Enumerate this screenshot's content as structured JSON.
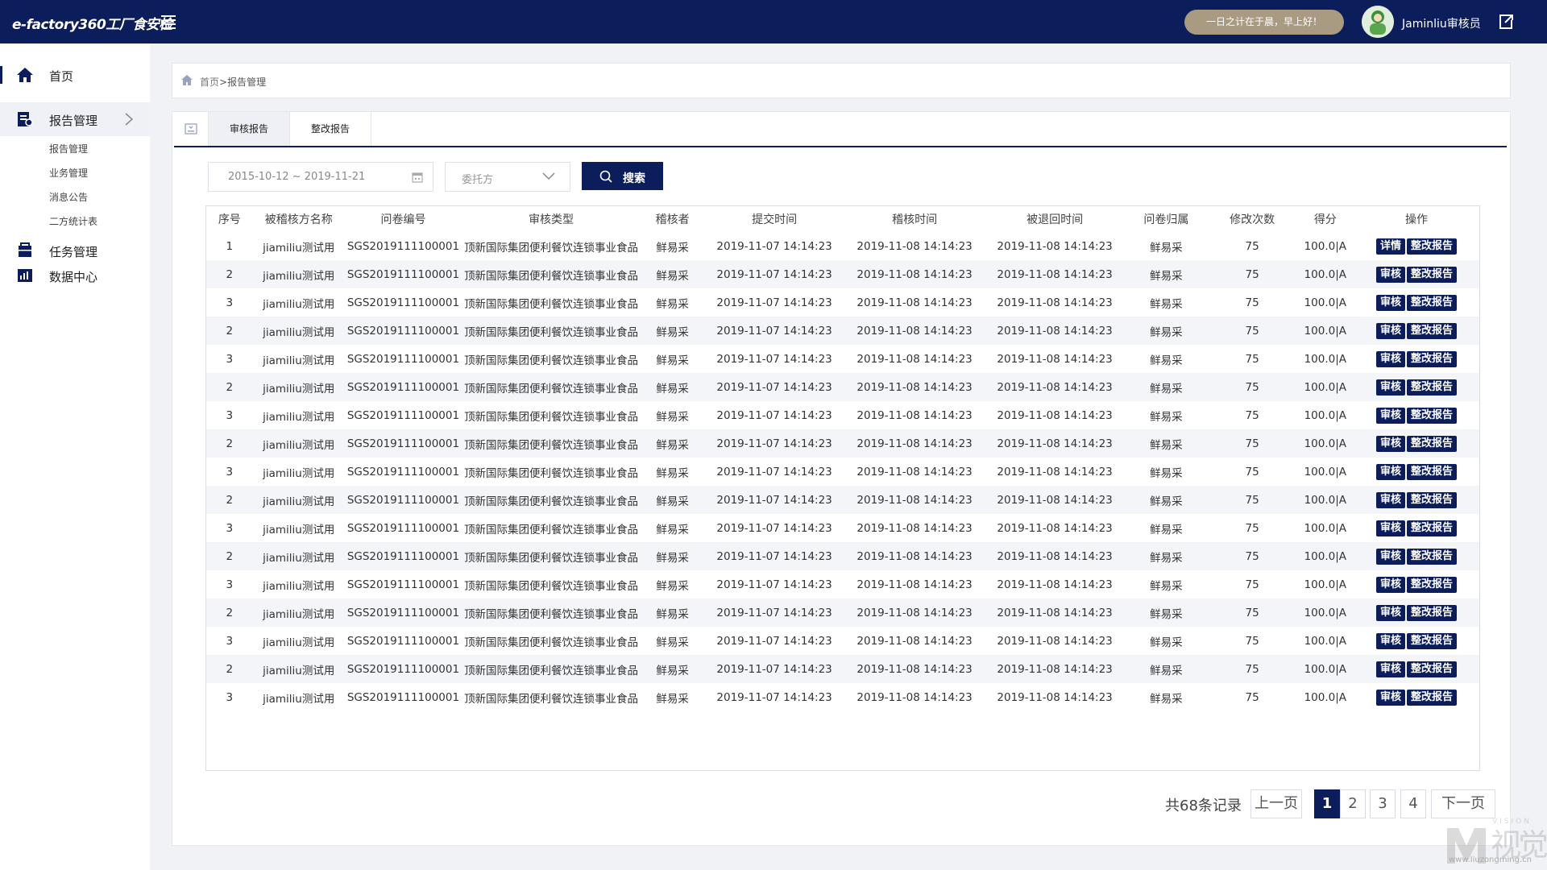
{
  "header": {
    "logo": "e-factory360工厂食安检",
    "slogan": "一日之计在于晨，早上好！",
    "username": "Jaminliu审核员"
  },
  "sidebar": {
    "items": [
      {
        "label": "首页",
        "icon": "home-icon"
      },
      {
        "label": "报告管理",
        "icon": "report-icon"
      },
      {
        "label": "任务管理",
        "icon": "task-icon"
      },
      {
        "label": "数据中心",
        "icon": "chart-icon"
      }
    ],
    "subitems": [
      "报告管理",
      "业务管理",
      "消息公告",
      "二方统计表"
    ]
  },
  "breadcrumb": {
    "home": "首页",
    "sep": ">",
    "current": "报告管理"
  },
  "tabs": [
    "审核报告",
    "整改报告"
  ],
  "filters": {
    "date_range": "2015-10-12 ~ 2019-11-21",
    "client_placeholder": "委托方",
    "search_label": "搜索"
  },
  "table": {
    "headers": [
      "序号",
      "被稽核方名称",
      "问卷编号",
      "审核类型",
      "稽核者",
      "提交时间",
      "稽核时间",
      "被退回时间",
      "问卷归属",
      "修改次数",
      "得分",
      "操作"
    ],
    "rows": [
      {
        "no": "1",
        "name": "jiamiliu测试用",
        "code": "SGS2019111100001",
        "type": "顶新国际集团便利餐饮连锁事业食品",
        "auditor": "鲜易采",
        "submit": "2019-11-07 14:14:23",
        "audit": "2019-11-08 14:14:23",
        "returned": "2019-11-08 14:14:23",
        "owner": "鲜易采",
        "edits": "75",
        "score": "100.0|A",
        "op1": "详情",
        "op2": "整改报告"
      },
      {
        "no": "2",
        "name": "jiamiliu测试用",
        "code": "SGS2019111100001",
        "type": "顶新国际集团便利餐饮连锁事业食品",
        "auditor": "鲜易采",
        "submit": "2019-11-07 14:14:23",
        "audit": "2019-11-08 14:14:23",
        "returned": "2019-11-08 14:14:23",
        "owner": "鲜易采",
        "edits": "75",
        "score": "100.0|A",
        "op1": "审核",
        "op2": "整改报告"
      },
      {
        "no": "3",
        "name": "jiamiliu测试用",
        "code": "SGS2019111100001",
        "type": "顶新国际集团便利餐饮连锁事业食品",
        "auditor": "鲜易采",
        "submit": "2019-11-07 14:14:23",
        "audit": "2019-11-08 14:14:23",
        "returned": "2019-11-08 14:14:23",
        "owner": "鲜易采",
        "edits": "75",
        "score": "100.0|A",
        "op1": "审核",
        "op2": "整改报告"
      },
      {
        "no": "2",
        "name": "jiamiliu测试用",
        "code": "SGS2019111100001",
        "type": "顶新国际集团便利餐饮连锁事业食品",
        "auditor": "鲜易采",
        "submit": "2019-11-07 14:14:23",
        "audit": "2019-11-08 14:14:23",
        "returned": "2019-11-08 14:14:23",
        "owner": "鲜易采",
        "edits": "75",
        "score": "100.0|A",
        "op1": "审核",
        "op2": "整改报告"
      },
      {
        "no": "3",
        "name": "jiamiliu测试用",
        "code": "SGS2019111100001",
        "type": "顶新国际集团便利餐饮连锁事业食品",
        "auditor": "鲜易采",
        "submit": "2019-11-07 14:14:23",
        "audit": "2019-11-08 14:14:23",
        "returned": "2019-11-08 14:14:23",
        "owner": "鲜易采",
        "edits": "75",
        "score": "100.0|A",
        "op1": "审核",
        "op2": "整改报告"
      },
      {
        "no": "2",
        "name": "jiamiliu测试用",
        "code": "SGS2019111100001",
        "type": "顶新国际集团便利餐饮连锁事业食品",
        "auditor": "鲜易采",
        "submit": "2019-11-07 14:14:23",
        "audit": "2019-11-08 14:14:23",
        "returned": "2019-11-08 14:14:23",
        "owner": "鲜易采",
        "edits": "75",
        "score": "100.0|A",
        "op1": "审核",
        "op2": "整改报告"
      },
      {
        "no": "3",
        "name": "jiamiliu测试用",
        "code": "SGS2019111100001",
        "type": "顶新国际集团便利餐饮连锁事业食品",
        "auditor": "鲜易采",
        "submit": "2019-11-07 14:14:23",
        "audit": "2019-11-08 14:14:23",
        "returned": "2019-11-08 14:14:23",
        "owner": "鲜易采",
        "edits": "75",
        "score": "100.0|A",
        "op1": "审核",
        "op2": "整改报告"
      },
      {
        "no": "2",
        "name": "jiamiliu测试用",
        "code": "SGS2019111100001",
        "type": "顶新国际集团便利餐饮连锁事业食品",
        "auditor": "鲜易采",
        "submit": "2019-11-07 14:14:23",
        "audit": "2019-11-08 14:14:23",
        "returned": "2019-11-08 14:14:23",
        "owner": "鲜易采",
        "edits": "75",
        "score": "100.0|A",
        "op1": "审核",
        "op2": "整改报告"
      },
      {
        "no": "3",
        "name": "jiamiliu测试用",
        "code": "SGS2019111100001",
        "type": "顶新国际集团便利餐饮连锁事业食品",
        "auditor": "鲜易采",
        "submit": "2019-11-07 14:14:23",
        "audit": "2019-11-08 14:14:23",
        "returned": "2019-11-08 14:14:23",
        "owner": "鲜易采",
        "edits": "75",
        "score": "100.0|A",
        "op1": "审核",
        "op2": "整改报告"
      },
      {
        "no": "2",
        "name": "jiamiliu测试用",
        "code": "SGS2019111100001",
        "type": "顶新国际集团便利餐饮连锁事业食品",
        "auditor": "鲜易采",
        "submit": "2019-11-07 14:14:23",
        "audit": "2019-11-08 14:14:23",
        "returned": "2019-11-08 14:14:23",
        "owner": "鲜易采",
        "edits": "75",
        "score": "100.0|A",
        "op1": "审核",
        "op2": "整改报告"
      },
      {
        "no": "3",
        "name": "jiamiliu测试用",
        "code": "SGS2019111100001",
        "type": "顶新国际集团便利餐饮连锁事业食品",
        "auditor": "鲜易采",
        "submit": "2019-11-07 14:14:23",
        "audit": "2019-11-08 14:14:23",
        "returned": "2019-11-08 14:14:23",
        "owner": "鲜易采",
        "edits": "75",
        "score": "100.0|A",
        "op1": "审核",
        "op2": "整改报告"
      },
      {
        "no": "2",
        "name": "jiamiliu测试用",
        "code": "SGS2019111100001",
        "type": "顶新国际集团便利餐饮连锁事业食品",
        "auditor": "鲜易采",
        "submit": "2019-11-07 14:14:23",
        "audit": "2019-11-08 14:14:23",
        "returned": "2019-11-08 14:14:23",
        "owner": "鲜易采",
        "edits": "75",
        "score": "100.0|A",
        "op1": "审核",
        "op2": "整改报告"
      },
      {
        "no": "3",
        "name": "jiamiliu测试用",
        "code": "SGS2019111100001",
        "type": "顶新国际集团便利餐饮连锁事业食品",
        "auditor": "鲜易采",
        "submit": "2019-11-07 14:14:23",
        "audit": "2019-11-08 14:14:23",
        "returned": "2019-11-08 14:14:23",
        "owner": "鲜易采",
        "edits": "75",
        "score": "100.0|A",
        "op1": "审核",
        "op2": "整改报告"
      },
      {
        "no": "2",
        "name": "jiamiliu测试用",
        "code": "SGS2019111100001",
        "type": "顶新国际集团便利餐饮连锁事业食品",
        "auditor": "鲜易采",
        "submit": "2019-11-07 14:14:23",
        "audit": "2019-11-08 14:14:23",
        "returned": "2019-11-08 14:14:23",
        "owner": "鲜易采",
        "edits": "75",
        "score": "100.0|A",
        "op1": "审核",
        "op2": "整改报告"
      },
      {
        "no": "3",
        "name": "jiamiliu测试用",
        "code": "SGS2019111100001",
        "type": "顶新国际集团便利餐饮连锁事业食品",
        "auditor": "鲜易采",
        "submit": "2019-11-07 14:14:23",
        "audit": "2019-11-08 14:14:23",
        "returned": "2019-11-08 14:14:23",
        "owner": "鲜易采",
        "edits": "75",
        "score": "100.0|A",
        "op1": "审核",
        "op2": "整改报告"
      },
      {
        "no": "2",
        "name": "jiamiliu测试用",
        "code": "SGS2019111100001",
        "type": "顶新国际集团便利餐饮连锁事业食品",
        "auditor": "鲜易采",
        "submit": "2019-11-07 14:14:23",
        "audit": "2019-11-08 14:14:23",
        "returned": "2019-11-08 14:14:23",
        "owner": "鲜易采",
        "edits": "75",
        "score": "100.0|A",
        "op1": "审核",
        "op2": "整改报告"
      },
      {
        "no": "3",
        "name": "jiamiliu测试用",
        "code": "SGS2019111100001",
        "type": "顶新国际集团便利餐饮连锁事业食品",
        "auditor": "鲜易采",
        "submit": "2019-11-07 14:14:23",
        "audit": "2019-11-08 14:14:23",
        "returned": "2019-11-08 14:14:23",
        "owner": "鲜易采",
        "edits": "75",
        "score": "100.0|A",
        "op1": "审核",
        "op2": "整改报告"
      }
    ]
  },
  "pagination": {
    "total": "共68条记录",
    "prev": "上一页",
    "pages": [
      "1",
      "2",
      "3",
      "4"
    ],
    "current": "1",
    "next": "下一页"
  },
  "watermark": {
    "text": "www.liuzongming.cn"
  },
  "colors": {
    "primary": "#0c1d5b",
    "slogan_bg": "#a99a82",
    "page_bg": "#f1f2f6"
  }
}
